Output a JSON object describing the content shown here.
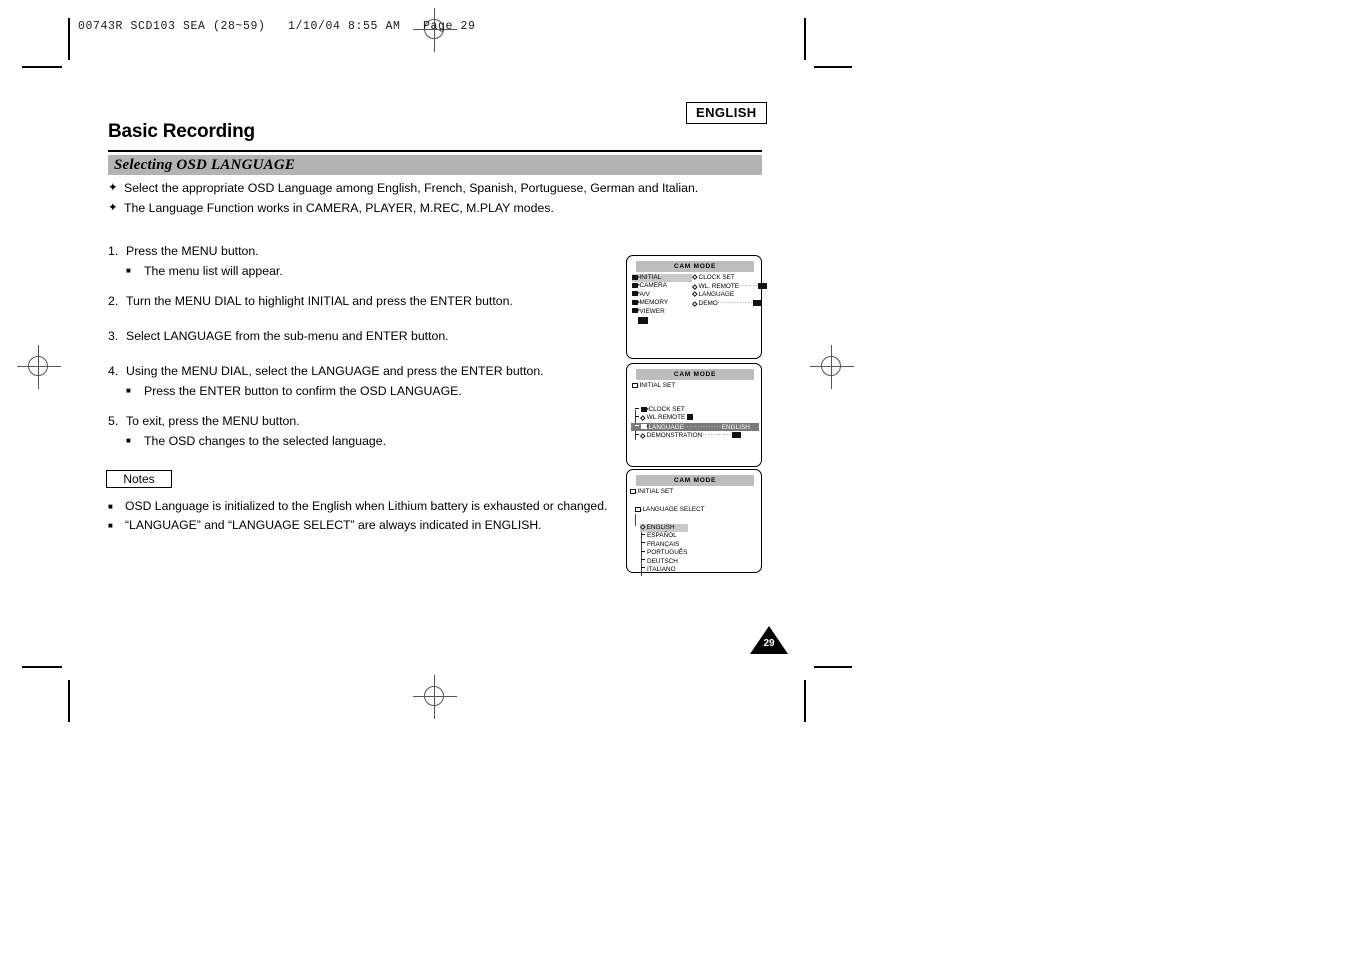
{
  "print_slug": "00743R SCD103 SEA (28~59)   1/10/04 8:55 AM   Page 29",
  "header": {
    "language_badge": "ENGLISH",
    "page_title": "Basic Recording",
    "section_title": "Selecting OSD LANGUAGE"
  },
  "intro_bullets": [
    {
      "mark": "✦",
      "text": "Select the appropriate OSD Language among English, French, Spanish, Portuguese, German and Italian."
    },
    {
      "mark": "✦",
      "text": "The Language Function works in CAMERA, PLAYER, M.REC, M.PLAY modes."
    }
  ],
  "steps": [
    {
      "num": "1.",
      "text": "Press the MENU button.",
      "subs": [
        {
          "mark": "■",
          "text": "The menu list will appear."
        }
      ]
    },
    {
      "num": "2.",
      "text": "Turn the MENU DIAL to highlight INITIAL and press the ENTER button.",
      "subs": []
    },
    {
      "num": "3.",
      "text": "Select LANGUAGE from the sub-menu and ENTER button.",
      "subs": []
    },
    {
      "num": "4.",
      "text": "Using the MENU DIAL, select the LANGUAGE and press the ENTER button.",
      "subs": [
        {
          "mark": "■",
          "text": "Press the ENTER button to confirm the OSD LANGUAGE."
        }
      ]
    },
    {
      "num": "5.",
      "text": "To exit, press the MENU button.",
      "subs": [
        {
          "mark": "■",
          "text": "The OSD changes to the selected language."
        }
      ]
    }
  ],
  "notes": {
    "tab_label": "Notes",
    "items": [
      {
        "mark": "■",
        "text": "OSD Language is initialized to the English when Lithium battery is exhausted or changed."
      },
      {
        "mark": "■",
        "text": "“LANGUAGE” and “LANGUAGE SELECT” are always indicated in ENGLISH."
      }
    ]
  },
  "osd_screens": [
    {
      "title": "CAM MODE",
      "left_menu": [
        {
          "label": "INITIAL",
          "highlighted": true
        },
        {
          "label": "CAMERA",
          "highlighted": false
        },
        {
          "label": "A/V",
          "highlighted": false
        },
        {
          "label": "MEMORY",
          "highlighted": false
        },
        {
          "label": "VIEWER",
          "highlighted": false
        }
      ],
      "right_menu": [
        {
          "label": "CLOCK  SET",
          "dots": "",
          "value": ""
        },
        {
          "label": "WL. REMOTE",
          "dots": "·······",
          "value": "chip"
        },
        {
          "label": "LANGUAGE",
          "dots": "",
          "value": ""
        },
        {
          "label": "DEMO",
          "dots": "·············",
          "value": "chip"
        }
      ]
    },
    {
      "title": "CAM MODE",
      "root_label": "INITIAL SET",
      "rows": [
        {
          "label": "CLOCK  SET",
          "icon": "folder",
          "dots": "",
          "value": "",
          "selected": false
        },
        {
          "label": "WL.REMOTE",
          "icon": "diamond",
          "dots": "",
          "value": "chip",
          "selected": false
        },
        {
          "label": "LANGUAGE",
          "icon": "folder",
          "dots": "··············",
          "value": "ENGLISH",
          "selected": true
        },
        {
          "label": "DEMONSTRATION",
          "icon": "diamond",
          "dots": "···········",
          "value": "chip",
          "selected": false
        }
      ]
    },
    {
      "title": "CAM MODE",
      "root_label": "INITIAL SET",
      "sub_label": "LANGUAGE SELECT",
      "languages": [
        {
          "label": "ENGLISH",
          "selected": true
        },
        {
          "label": "ESPAÑOL",
          "selected": false
        },
        {
          "label": "FRANÇAIS",
          "selected": false
        },
        {
          "label": "PORTUGUÊS",
          "selected": false
        },
        {
          "label": "DEUTSCH",
          "selected": false
        },
        {
          "label": "ITALIANO",
          "selected": false
        }
      ]
    }
  ],
  "page_number": "29"
}
